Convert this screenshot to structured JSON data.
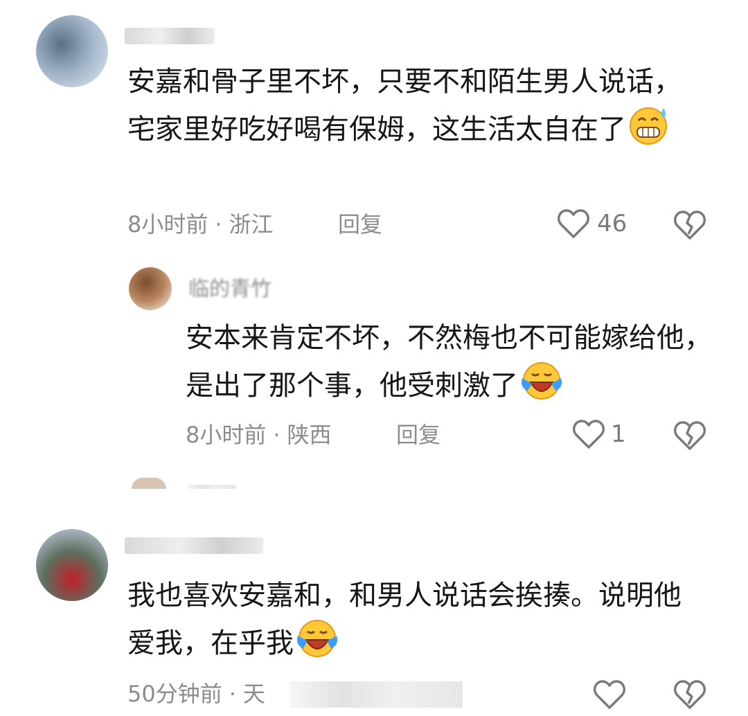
{
  "comments": [
    {
      "text": "安嘉和骨子里不坏，只要不和陌生男人说话，宅家里好吃好喝有保姆，这生活太自在了",
      "emoji": "sweat-grin-emoji",
      "time": "8小时前",
      "location": "浙江",
      "reply_label": "回复",
      "likes": "46",
      "reply": {
        "username": "临的青竹",
        "text": "安本来肯定不坏，不然梅也不可能嫁给他，是出了那个事，他受刺激了",
        "emoji": "laughing-crying-emoji",
        "time": "8小时前",
        "location": "陕西",
        "reply_label": "回复",
        "likes": "1"
      }
    },
    {
      "text": "我也喜欢安嘉和，和男人说话会挨揍。说明他爱我，在乎我",
      "emoji": "laughing-crying-emoji",
      "time": "50分钟前",
      "location": "天",
      "reply_label": "",
      "likes": ""
    }
  ],
  "colors": {
    "meta_gray": "#8c8c8c",
    "text": "#161616"
  },
  "icons": [
    "heart-outline-icon",
    "broken-heart-icon"
  ]
}
